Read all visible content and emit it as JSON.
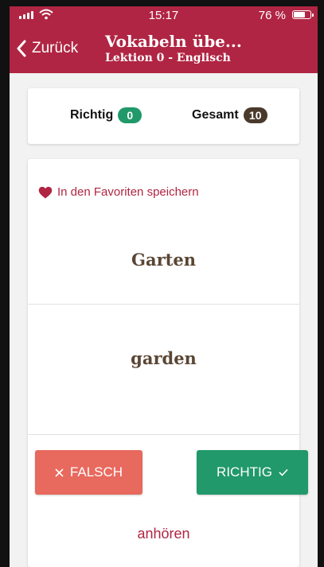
{
  "status_bar": {
    "time": "15:17",
    "battery": "76 %",
    "battery_level": 0.76
  },
  "header": {
    "back_label": "Zurück",
    "title": "Vokabeln übe...",
    "subtitle": "Lektion 0 - Englisch"
  },
  "score": {
    "correct_label": "Richtig",
    "correct_count": "0",
    "total_label": "Gesamt",
    "total_count": "10"
  },
  "card": {
    "favorite_label": "In den Favoriten speichern",
    "question": "Garten",
    "answer": "garden"
  },
  "actions": {
    "wrong_label": "FALSCH",
    "right_label": "RICHTIG",
    "listen_label": "anhören"
  },
  "colors": {
    "brand": "#b02543",
    "correct_badge": "#21996a",
    "total_badge": "#4a3a2c",
    "wrong_button": "#e8695e",
    "right_button": "#21996a",
    "word_text": "#5a4634"
  },
  "icons": {
    "back": "chevron-left-icon",
    "favorite": "heart-icon",
    "wrong": "close-icon",
    "right": "check-icon",
    "signal": "signal-icon",
    "wifi": "wifi-icon",
    "battery": "battery-icon"
  }
}
